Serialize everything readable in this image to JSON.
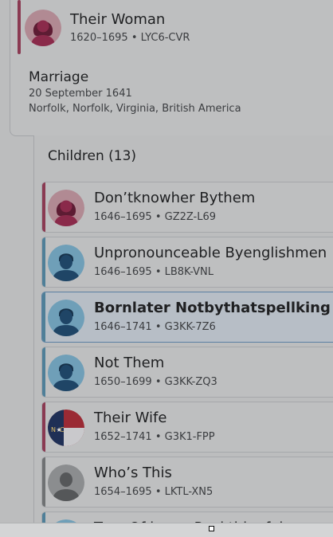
{
  "spouse": {
    "name": "Their Woman",
    "lifespan": "1620–1695",
    "pid": "LYC6-CVR",
    "separator": "•",
    "gender": "female",
    "avatar_icon": "female-silhouette-icon"
  },
  "marriage": {
    "label": "Marriage",
    "date": "20 September 1641",
    "place": "Norfolk, Norfolk, Virginia, British America"
  },
  "children": {
    "header": "Children (13)",
    "items": [
      {
        "name": "Don’tknowher Bythem",
        "lifespan": "1646–1695",
        "pid": "GZ2Z-L69",
        "gender": "female",
        "avatar_icon": "female-silhouette-icon",
        "selected": false
      },
      {
        "name": "Unpronounceable Byenglishmen",
        "lifespan": "1646–1695",
        "pid": "LB8K-VNL",
        "gender": "male",
        "avatar_icon": "male-silhouette-icon",
        "selected": false
      },
      {
        "name": "Bornlater Notbythatspellking Forp...",
        "lifespan": "1646–1741",
        "pid": "G3KK-7Z6",
        "gender": "male",
        "avatar_icon": "male-silhouette-icon",
        "selected": true
      },
      {
        "name": "Not Them",
        "lifespan": "1650–1699",
        "pid": "G3KK-ZQ3",
        "gender": "male",
        "avatar_icon": "male-silhouette-icon",
        "selected": false
      },
      {
        "name": "Their Wife",
        "lifespan": "1652–1741",
        "pid": "G3K1-FPP",
        "gender": "female",
        "avatar_icon": "state-flag-photo-icon",
        "selected": false
      },
      {
        "name": "Who’s This",
        "lifespan": "1654–1695",
        "pid": "LKTL-XN5",
        "gender": "unknown",
        "avatar_icon": "unknown-silhouette-icon",
        "selected": false
      },
      {
        "name": "Tw... Of kno... Reckthi... fol",
        "lifespan": "",
        "pid": "",
        "gender": "male",
        "avatar_icon": "male-silhouette-icon",
        "selected": false
      }
    ]
  },
  "colors": {
    "female_bar": "#8a3a52",
    "male_bar": "#4f7f98",
    "unknown_bar": "#6f7173",
    "selected_border": "#5a7fa2"
  }
}
